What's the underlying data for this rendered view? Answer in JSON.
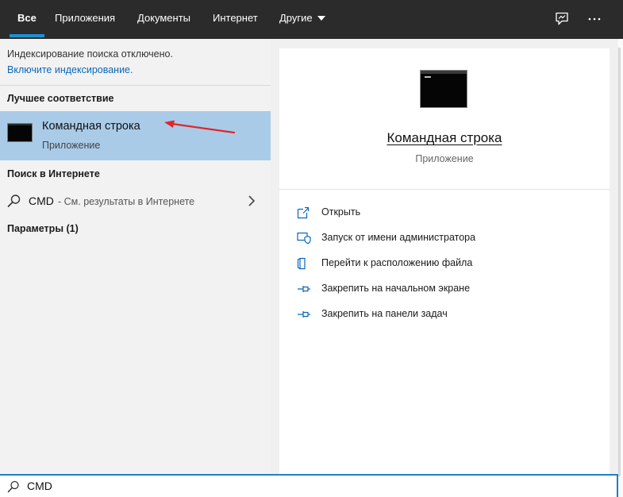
{
  "nav": {
    "tabs": [
      {
        "label": "Все",
        "active": true
      },
      {
        "label": "Приложения"
      },
      {
        "label": "Документы"
      },
      {
        "label": "Интернет"
      },
      {
        "label": "Другие"
      }
    ],
    "icons": [
      "feedback-icon",
      "more-icon"
    ]
  },
  "left": {
    "hint": "Индексирование поиска отключено.",
    "enable_link": "Включите индексирование.",
    "best_match_header": "Лучшее соответствие",
    "best_match": {
      "title": "Командная строка",
      "subtitle": "Приложение",
      "icon": "command-prompt-icon"
    },
    "web_header": "Поиск в Интернете",
    "web_result": {
      "query": "CMD",
      "suffix": "- См. результаты в Интернете",
      "icon": "search-icon"
    },
    "settings_header": "Параметры (1)"
  },
  "detail": {
    "title": "Командная строка",
    "type": "Приложение",
    "actions": [
      {
        "label": "Открыть",
        "icon": "open-icon"
      },
      {
        "label": "Запуск от имени администратора",
        "icon": "shield-icon"
      },
      {
        "label": "Перейти к расположению файла",
        "icon": "file-location-icon"
      },
      {
        "label": "Закрепить на начальном экране",
        "icon": "pin-icon"
      },
      {
        "label": "Закрепить на панели задач",
        "icon": "pin-icon"
      }
    ]
  },
  "search": {
    "value": "CMD"
  },
  "colors": {
    "accent": "#1e90d0",
    "topbar": "#2b2b2b",
    "selected": "#a9cbe8",
    "annotation_arrow": "#e0262a"
  }
}
